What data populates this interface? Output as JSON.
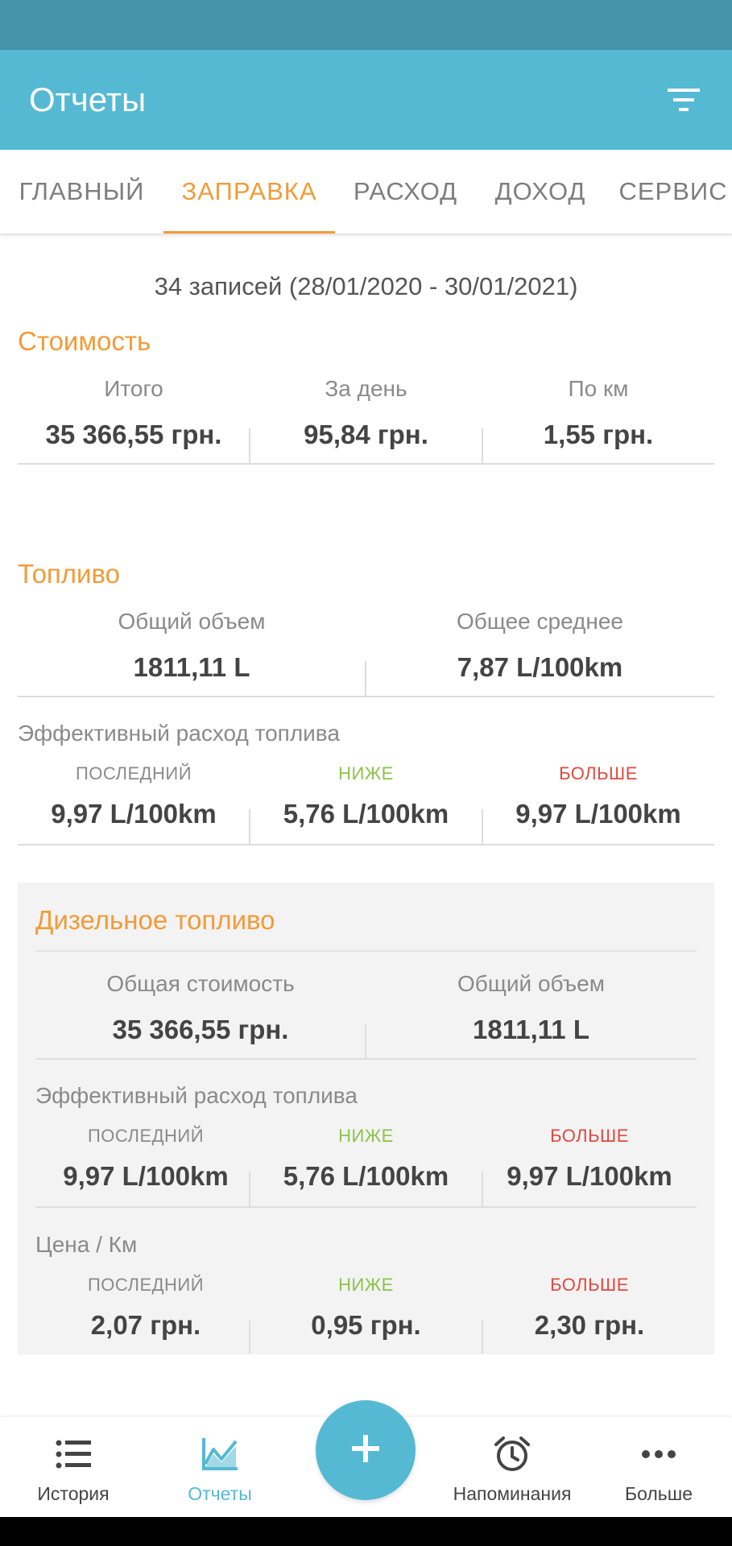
{
  "app": {
    "title": "Отчеты"
  },
  "tabs": [
    {
      "label": "ГЛАВНЫЙ"
    },
    {
      "label": "ЗАПРАВКА"
    },
    {
      "label": "РАСХОД"
    },
    {
      "label": "ДОХОД"
    },
    {
      "label": "СЕРВИС"
    }
  ],
  "summary": "34 записей (28/01/2020 - 30/01/2021)",
  "cost": {
    "title": "Стоимость",
    "items": [
      {
        "label": "Итого",
        "value": "35 366,55 грн."
      },
      {
        "label": "За день",
        "value": "95,84 грн."
      },
      {
        "label": "По км",
        "value": "1,55 грн."
      }
    ]
  },
  "fuel": {
    "title": "Топливо",
    "items": [
      {
        "label": "Общий объем",
        "value": "1811,11 L"
      },
      {
        "label": "Общее среднее",
        "value": "7,87 L/100km"
      }
    ],
    "efficiency": {
      "title": "Эффективный расход топлива",
      "items": [
        {
          "label": "ПОСЛЕДНИЙ",
          "value": "9,97 L/100km"
        },
        {
          "label": "НИЖЕ",
          "value": "5,76 L/100km"
        },
        {
          "label": "БОЛЬШЕ",
          "value": "9,97 L/100km"
        }
      ]
    }
  },
  "diesel": {
    "title": "Дизельное топливо",
    "items": [
      {
        "label": "Общая стоимость",
        "value": "35 366,55 грн."
      },
      {
        "label": "Общий объем",
        "value": "1811,11 L"
      }
    ],
    "efficiency": {
      "title": "Эффективный расход топлива",
      "items": [
        {
          "label": "ПОСЛЕДНИЙ",
          "value": "9,97 L/100km"
        },
        {
          "label": "НИЖЕ",
          "value": "5,76 L/100km"
        },
        {
          "label": "БОЛЬШЕ",
          "value": "9,97 L/100km"
        }
      ]
    },
    "price_per_km": {
      "title": "Цена / Км",
      "items": [
        {
          "label": "ПОСЛЕДНИЙ",
          "value": "2,07 грн."
        },
        {
          "label": "НИЖЕ",
          "value": "0,95 грн."
        },
        {
          "label": "БОЛЬШЕ",
          "value": "2,30 грн."
        }
      ]
    }
  },
  "bottom_nav": [
    {
      "label": "История",
      "icon": "list-icon"
    },
    {
      "label": "Отчеты",
      "icon": "chart-icon"
    },
    {
      "label": "Напоминания",
      "icon": "alarm-clock-icon"
    },
    {
      "label": "Больше",
      "icon": "more-dots-icon"
    }
  ],
  "fab": {
    "icon": "plus-icon"
  },
  "colors": {
    "primary": "#55b9d3",
    "status_bar": "#4593a8",
    "accent": "#f29b38",
    "green": "#8bc34a",
    "red": "#e04a3f"
  }
}
